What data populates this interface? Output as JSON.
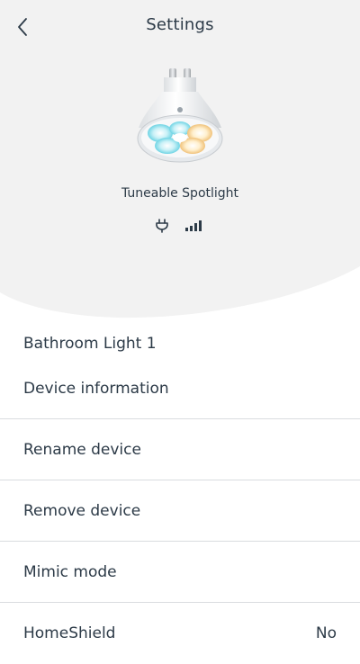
{
  "header": {
    "title": "Settings",
    "back_icon": "chevron-left-icon"
  },
  "device": {
    "name": "Tuneable Spotlight",
    "image": "gu10-spotlight-bulb",
    "status_icons": [
      "power-plug-icon",
      "signal-strength-icon"
    ]
  },
  "room": {
    "name": "Bathroom Light 1"
  },
  "menu": {
    "items": [
      {
        "label": "Device information",
        "value": ""
      },
      {
        "label": "Rename device",
        "value": ""
      },
      {
        "label": "Remove device",
        "value": ""
      },
      {
        "label": "Mimic mode",
        "value": ""
      },
      {
        "label": "HomeShield",
        "value": "No"
      }
    ]
  },
  "colors": {
    "top_background": "#f2f2f2",
    "text": "#2c3a47",
    "divider": "#d9dcdf"
  }
}
